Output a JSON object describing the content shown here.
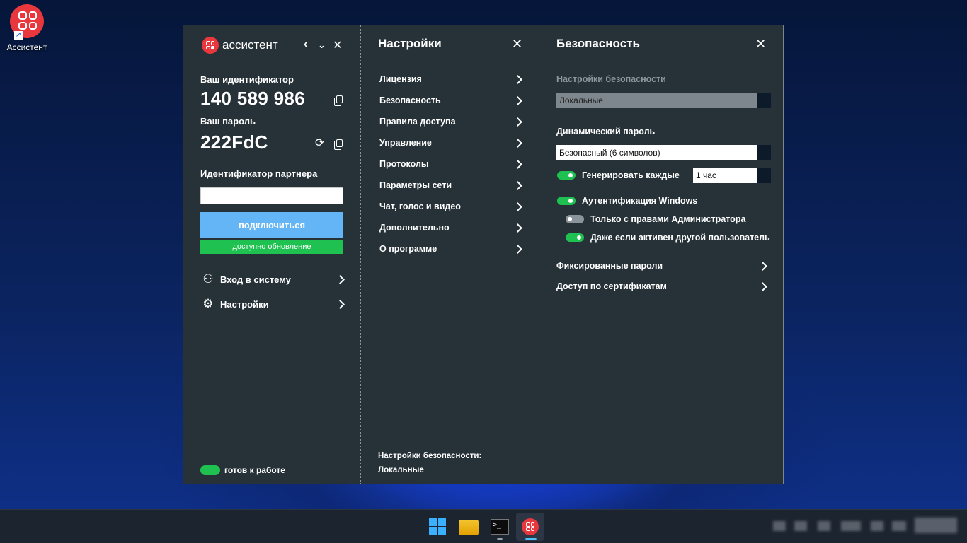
{
  "desktop": {
    "icon_label": "Ассистент"
  },
  "app": {
    "brand": "ассистент",
    "panel1": {
      "id_label": "Ваш идентификатор",
      "id_value": "140 589 986",
      "pwd_label": "Ваш пароль",
      "pwd_value": "222FdC",
      "partner_label": "Идентификатор партнера",
      "partner_value": "",
      "connect_label": "подключиться",
      "update_label": "доступно обновление",
      "menu": [
        {
          "label": "Вход в систему",
          "icon": "user-icon"
        },
        {
          "label": "Настройки",
          "icon": "gears-icon"
        }
      ],
      "status": "готов к работе"
    },
    "panel2": {
      "title": "Настройки",
      "items": [
        "Лицензия",
        "Безопасность",
        "Правила доступа",
        "Управление",
        "Протоколы",
        "Параметры сети",
        "Чат, голос и видео",
        "Дополнительно",
        "О программе"
      ],
      "footer_label": "Настройки безопасности:",
      "footer_value": "Локальные"
    },
    "panel3": {
      "title": "Безопасность",
      "security_settings_label": "Настройки безопасности",
      "security_settings_value": "Локальные",
      "dynamic_password_label": "Динамический пароль",
      "dynamic_password_value": "Безопасный (6 символов)",
      "generate_label": "Генерировать каждые",
      "generate_value": "1 час",
      "generate_on": true,
      "windows_auth_label": "Аутентификация Windows",
      "windows_auth_on": true,
      "admin_only_label": "Только с правами Администратора",
      "admin_only_on": false,
      "other_user_label": "Даже если активен другой пользователь",
      "other_user_on": true,
      "fixed_passwords_label": "Фиксированные пароли",
      "cert_access_label": "Доступ по сертификатам"
    }
  },
  "colors": {
    "panel_bg": "#263238",
    "accent_red": "#e8383d",
    "connect_blue": "#64b5f6",
    "green": "#1fc150"
  }
}
